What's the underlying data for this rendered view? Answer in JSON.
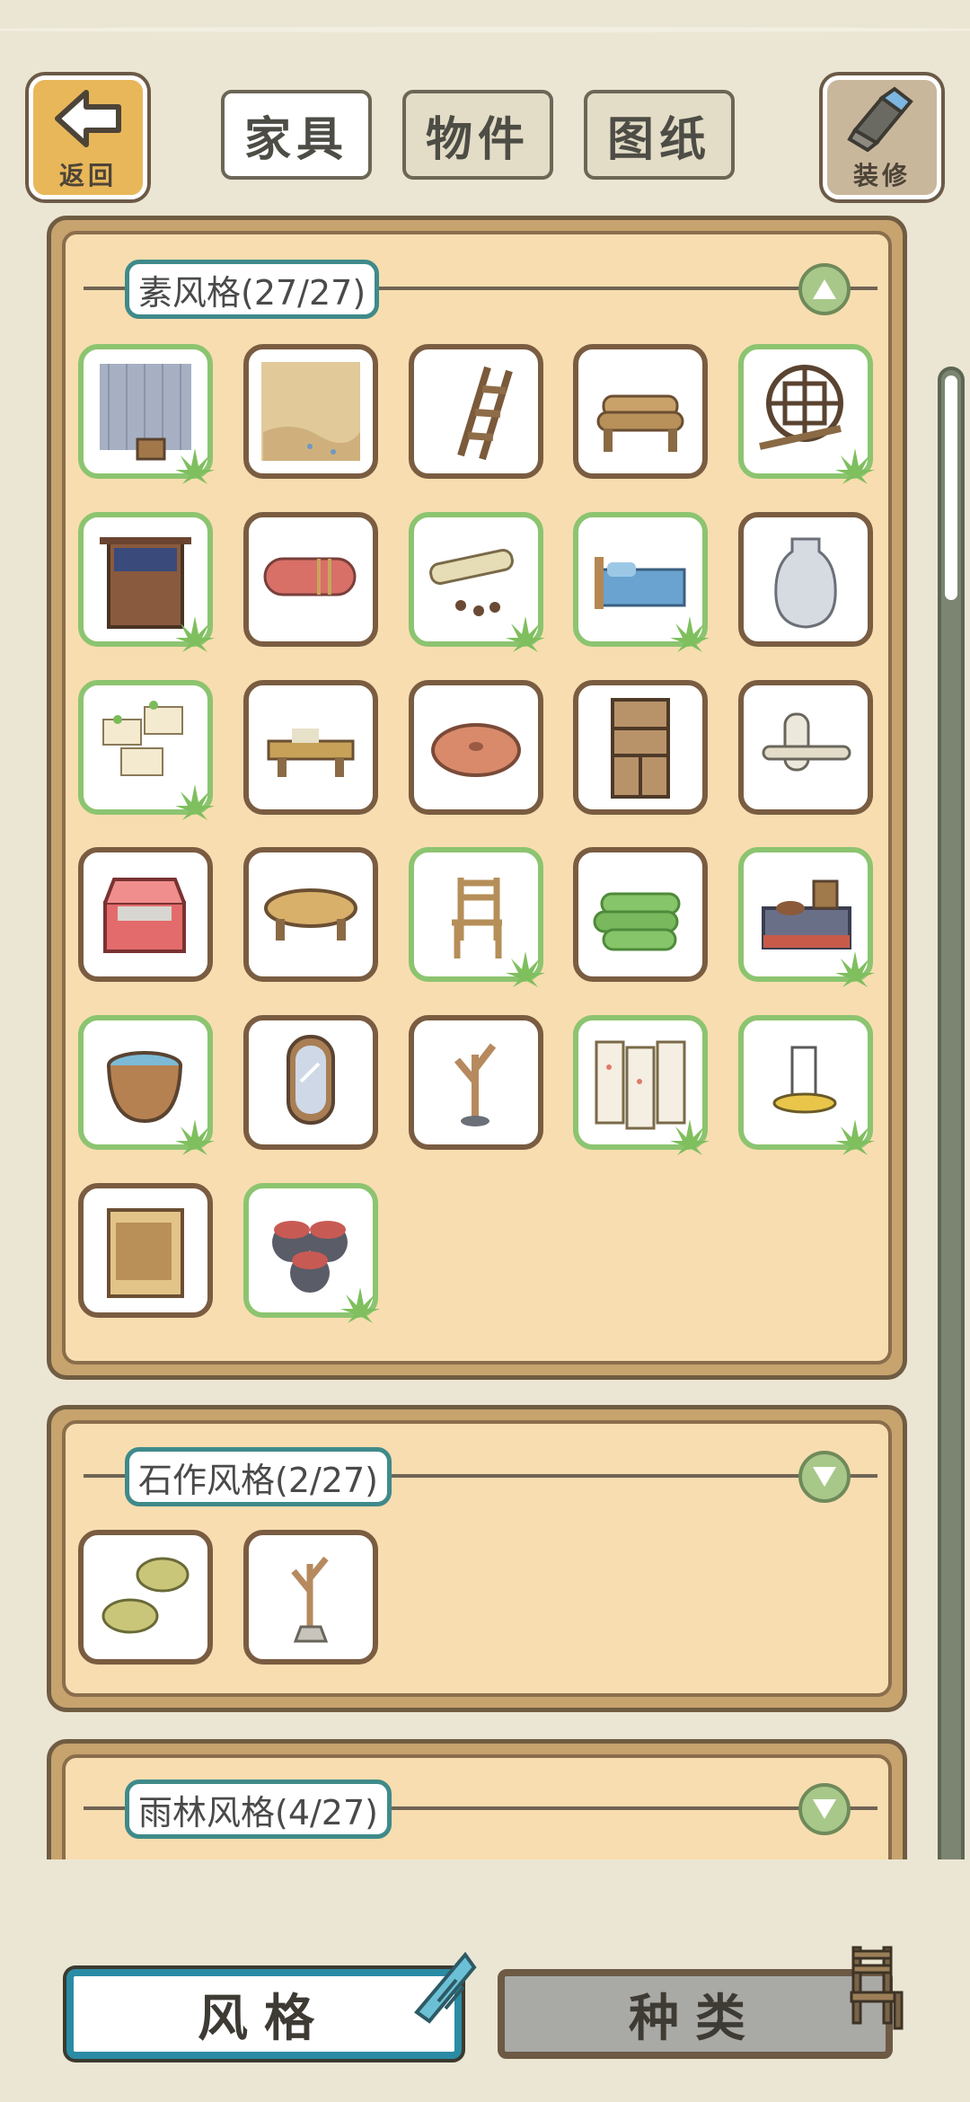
{
  "top_bar": {
    "back": {
      "label": "返回",
      "icon": "back-arrow-icon"
    },
    "repair": {
      "label": "装修",
      "icon": "paint-brush-icon"
    },
    "tabs": [
      {
        "label": "家具",
        "active": true
      },
      {
        "label": "物件",
        "active": false
      },
      {
        "label": "图纸",
        "active": false
      }
    ]
  },
  "categories": [
    {
      "label": "素风格(27/27)",
      "expanded": true,
      "items": [
        {
          "name": "shower-curtain-bucket",
          "frog": true
        },
        {
          "name": "sand-mat",
          "frog": false
        },
        {
          "name": "wooden-ladder",
          "frog": false
        },
        {
          "name": "log-bench",
          "frog": false
        },
        {
          "name": "lattice-window",
          "frog": true
        },
        {
          "name": "noren-cabinet",
          "frog": true
        },
        {
          "name": "rolled-blanket",
          "frog": false
        },
        {
          "name": "scroll-with-seeds",
          "frog": true
        },
        {
          "name": "blue-futon-bed",
          "frog": true
        },
        {
          "name": "white-vase",
          "frog": false
        },
        {
          "name": "memo-board",
          "frog": true
        },
        {
          "name": "low-writing-desk",
          "frog": false
        },
        {
          "name": "round-cushion",
          "frog": false
        },
        {
          "name": "bookshelf",
          "frog": false
        },
        {
          "name": "paper-scrolls",
          "frog": false
        },
        {
          "name": "red-chest",
          "frog": false
        },
        {
          "name": "round-low-table",
          "frog": false
        },
        {
          "name": "wooden-chair",
          "frog": true
        },
        {
          "name": "green-rolls",
          "frog": false
        },
        {
          "name": "cooking-stove",
          "frog": true
        },
        {
          "name": "wooden-tub",
          "frog": true
        },
        {
          "name": "standing-mirror",
          "frog": false
        },
        {
          "name": "branch-stand",
          "frog": false
        },
        {
          "name": "folding-screen",
          "frog": true
        },
        {
          "name": "candle-holder",
          "frog": true
        },
        {
          "name": "small-cupboard",
          "frog": false
        },
        {
          "name": "clay-jars",
          "frog": true
        }
      ]
    },
    {
      "label": "石作风格(2/27)",
      "expanded": false,
      "items": [
        {
          "name": "leaf-notes",
          "frog": false
        },
        {
          "name": "stone-branch-stand",
          "frog": false
        }
      ]
    },
    {
      "label": "雨林风格(4/27)",
      "expanded": false,
      "items": []
    }
  ],
  "bottom_bar": {
    "style_label": "风格",
    "kind_label": "种类"
  },
  "colors": {
    "background": "#ebe6d3",
    "panel": "#f8ddb0",
    "frog_border": "#8cc470",
    "owned_border": "#7a5c41",
    "accent_teal": "#2a8ca4"
  }
}
